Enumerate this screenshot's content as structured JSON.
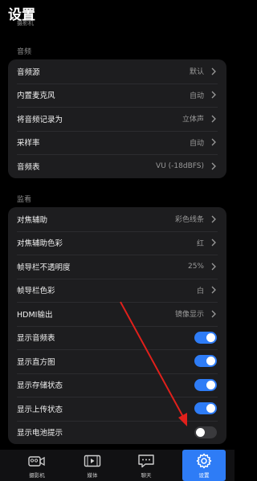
{
  "header": {
    "title": "设置",
    "subtitle": "摄影机"
  },
  "audio": {
    "section_label": "音频",
    "items": [
      {
        "label": "音频源",
        "value": "默认"
      },
      {
        "label": "内置麦克风",
        "value": "自动"
      },
      {
        "label": "将音频记录为",
        "value": "立体声"
      },
      {
        "label": "采样率",
        "value": "自动"
      },
      {
        "label": "音频表",
        "value": "VU (-18dBFS)"
      }
    ]
  },
  "monitor": {
    "section_label": "监看",
    "items": [
      {
        "label": "对焦辅助",
        "value": "彩色线条"
      },
      {
        "label": "对焦辅助色彩",
        "value": "红"
      },
      {
        "label": "帧导栏不透明度",
        "value": "25%"
      },
      {
        "label": "帧导栏色彩",
        "value": "白"
      },
      {
        "label": "HDMI输出",
        "value": "镜像显示"
      }
    ],
    "toggles": [
      {
        "label": "显示音频表",
        "on": true
      },
      {
        "label": "显示直方图",
        "on": true
      },
      {
        "label": "显示存储状态",
        "on": true
      },
      {
        "label": "显示上传状态",
        "on": true
      },
      {
        "label": "显示电池提示",
        "on": false
      }
    ]
  },
  "tabbar": {
    "items": [
      {
        "label": "摄影机",
        "icon": "camera-icon",
        "active": false
      },
      {
        "label": "媒体",
        "icon": "film-icon",
        "active": false
      },
      {
        "label": "聊天",
        "icon": "chat-icon",
        "active": false
      },
      {
        "label": "设置",
        "icon": "gear-icon",
        "active": true
      }
    ]
  },
  "colors": {
    "accent": "#2e7cf6",
    "annotation_arrow": "#e0201b"
  }
}
